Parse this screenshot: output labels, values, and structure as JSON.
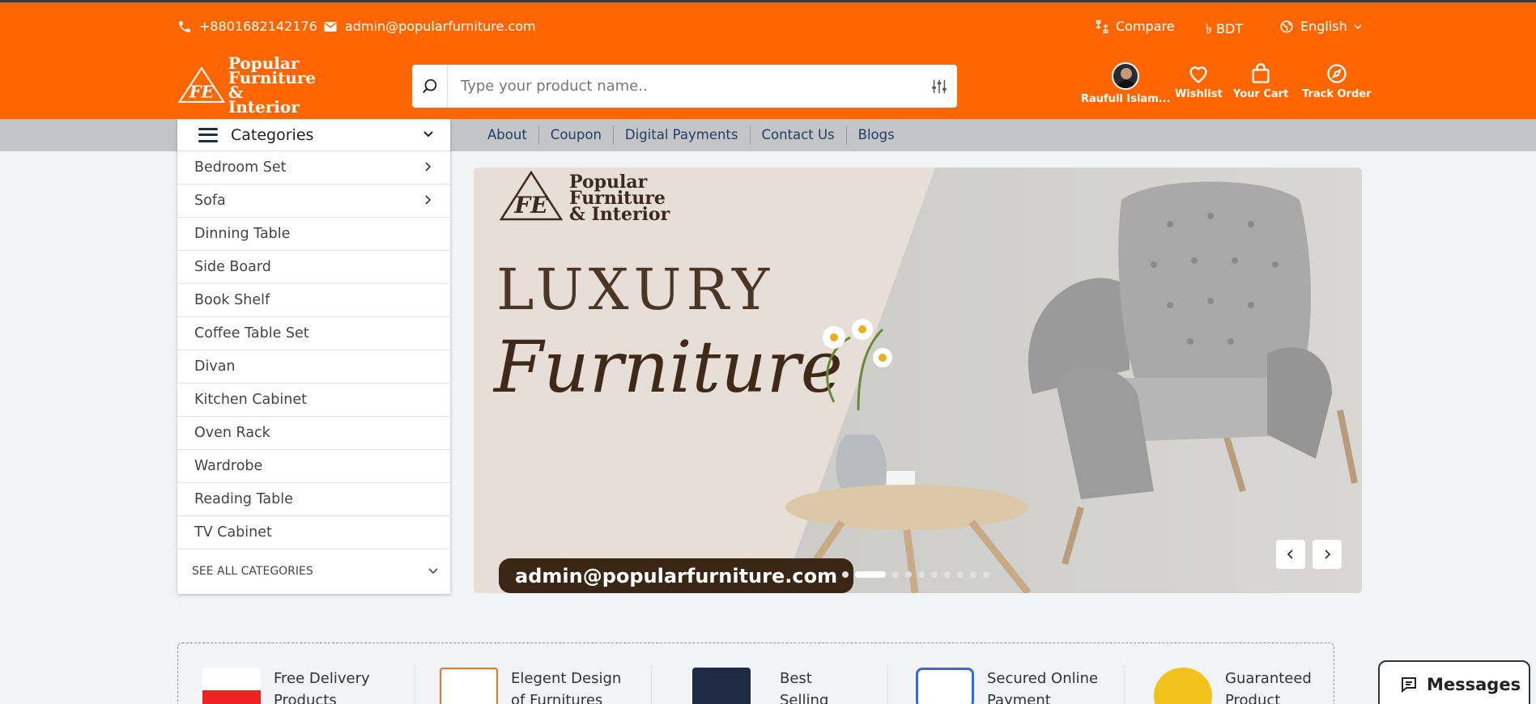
{
  "topbar": {
    "phone": "+8801682142176",
    "email": "admin@popularfurniture.com",
    "compare": "Compare",
    "currency": "৳ BDT",
    "language": "English"
  },
  "brand": {
    "logo_mark": "FE",
    "line1": "Popular",
    "line2": "Furniture",
    "line3": "& Interior"
  },
  "search": {
    "placeholder": "Type your product name.."
  },
  "header_icons": {
    "user": "Raufull Islam...",
    "wishlist": "Wishlist",
    "cart": "Your Cart",
    "track": "Track Order"
  },
  "categories": {
    "title": "Categories",
    "items": [
      {
        "label": "Bedroom Set",
        "has_sub": true
      },
      {
        "label": "Sofa",
        "has_sub": true
      },
      {
        "label": "Dinning Table",
        "has_sub": false
      },
      {
        "label": "Side Board",
        "has_sub": false
      },
      {
        "label": "Book Shelf",
        "has_sub": false
      },
      {
        "label": "Coffee Table Set",
        "has_sub": false
      },
      {
        "label": "Divan",
        "has_sub": false
      },
      {
        "label": "Kitchen Cabinet",
        "has_sub": false
      },
      {
        "label": "Oven Rack",
        "has_sub": false
      },
      {
        "label": "Wardrobe",
        "has_sub": false
      },
      {
        "label": "Reading Table",
        "has_sub": false
      },
      {
        "label": "TV Cabinet",
        "has_sub": false
      }
    ],
    "see_all": "SEE ALL CATEGORIES"
  },
  "nav": [
    "About",
    "Coupon",
    "Digital Payments",
    "Contact Us",
    "Blogs"
  ],
  "banner": {
    "logo_line1": "Popular",
    "logo_line2": "Furniture",
    "logo_line3": "& Interior",
    "headline": "LUXURY",
    "script": "Furniture",
    "email": "admin@popularfurniture.com",
    "slide_count": 10,
    "active_slide": 2
  },
  "features": [
    {
      "line1": "Free Delivery",
      "line2": "Products",
      "icon": "free-delivery-icon"
    },
    {
      "line1": "Elegent Design",
      "line2": "of Furnitures",
      "icon": "design-icon"
    },
    {
      "line1": "Best",
      "line2": "Selling",
      "icon": "best-badge-icon"
    },
    {
      "line1": "Secured Online",
      "line2": "Payment",
      "icon": "secure-shield-icon"
    },
    {
      "line1": "Guaranteed",
      "line2": "Product",
      "icon": "quality-seal-icon"
    }
  ],
  "messages": {
    "label": "Messages"
  },
  "colors": {
    "primary": "#ff6600",
    "nav_bg": "#c4c5c7",
    "nav_link": "#1f3d66"
  }
}
